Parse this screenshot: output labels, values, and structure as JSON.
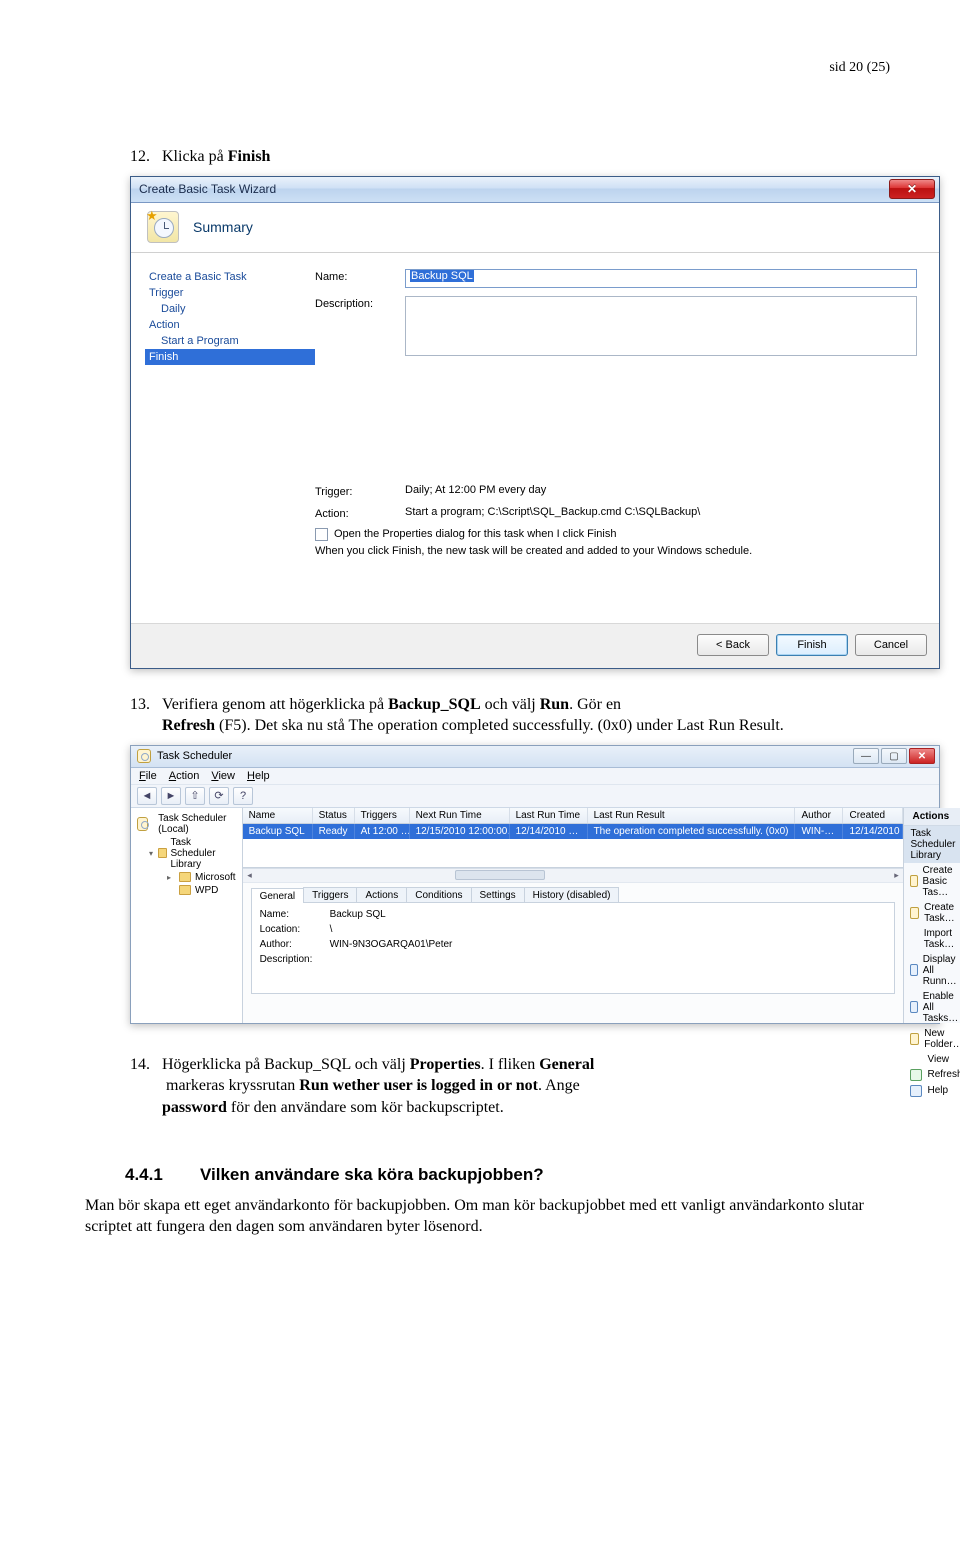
{
  "page_header": "sid 20 (25)",
  "step12": {
    "num": "12.",
    "before": "Klicka på ",
    "bold": "Finish"
  },
  "wizard": {
    "window_title": "Create Basic Task Wizard",
    "heading": "Summary",
    "nav": {
      "create": "Create a Basic Task",
      "trigger": "Trigger",
      "daily": "Daily",
      "action": "Action",
      "start": "Start a Program",
      "finish": "Finish"
    },
    "labels": {
      "name": "Name:",
      "description": "Description:",
      "trigger": "Trigger:",
      "action": "Action:"
    },
    "name_value": "Backup SQL",
    "trigger_value": "Daily; At 12:00 PM every day",
    "action_value": "Start a program; C:\\Script\\SQL_Backup.cmd C:\\SQLBackup\\",
    "checkbox_label": "Open the Properties dialog for this task when I click Finish",
    "note": "When you click Finish, the new task will be created and added to your Windows schedule.",
    "buttons": {
      "back": "< Back",
      "finish": "Finish",
      "cancel": "Cancel"
    }
  },
  "step13": {
    "num": "13.",
    "t1": "Verifiera genom att högerklicka på ",
    "b1": "Backup_SQL",
    "t2": " och välj ",
    "b2": "Run",
    "t3": ". Gör en ",
    "b4": "Refresh",
    "t4": " (F5). Det ska nu stå The operation completed successfully. (0x0) under Last Run Result."
  },
  "ts": {
    "title": "Task Scheduler",
    "menu": {
      "file": "File",
      "action": "Action",
      "view": "View",
      "help": "Help"
    },
    "tree": {
      "root": "Task Scheduler (Local)",
      "lib": "Task Scheduler Library",
      "ms": "Microsoft",
      "wpd": "WPD"
    },
    "cols": {
      "name": "Name",
      "status": "Status",
      "triggers": "Triggers",
      "next": "Next Run Time",
      "lastrun": "Last Run Time",
      "lastres": "Last Run Result",
      "author": "Author",
      "created": "Created"
    },
    "row": {
      "name": "Backup SQL",
      "status": "Ready",
      "triggers": "At 12:00 …",
      "next": "12/15/2010 12:00:00…",
      "lastrun": "12/14/2010 …",
      "lastres": "The operation completed successfully. (0x0)",
      "author": "WIN-…",
      "created": "12/14/2010"
    },
    "tabs": {
      "general": "General",
      "triggers": "Triggers",
      "actions": "Actions",
      "conditions": "Conditions",
      "settings": "Settings",
      "history": "History (disabled)"
    },
    "detail": {
      "name_l": "Name:",
      "name_v": "Backup SQL",
      "loc_l": "Location:",
      "loc_v": "\\",
      "auth_l": "Author:",
      "auth_v": "WIN-9N3OGARQA01\\Peter",
      "desc_l": "Description:"
    },
    "actions_head": "Actions",
    "actions_sub": "Task Scheduler Library",
    "actions": {
      "a0": "Create Basic Tas…",
      "a1": "Create Task…",
      "a2": "Import Task…",
      "a3": "Display All Runn…",
      "a4": "Enable All Tasks…",
      "a5": "New Folder…",
      "a6": "View",
      "a7": "Refresh",
      "a8": "Help"
    }
  },
  "step14": {
    "num": "14.",
    "t1": "Högerklicka på Backup_SQL och välj ",
    "b1": "Properties",
    "t2": ". I fliken ",
    "b2": "General",
    "t3": " markeras kryssrutan ",
    "b3": "Run wether user is logged in or not",
    "t4": ". Ange ",
    "b4": "password",
    "t5": " för den användare som kör backupscriptet."
  },
  "section": {
    "num": "4.4.1",
    "title": "Vilken användare ska köra backupjobben?"
  },
  "section_body": "Man bör skapa ett eget användarkonto för backupjobben. Om man kör backupjobbet med ett vanligt användarkonto slutar scriptet att fungera den dagen som användaren byter lösenord."
}
